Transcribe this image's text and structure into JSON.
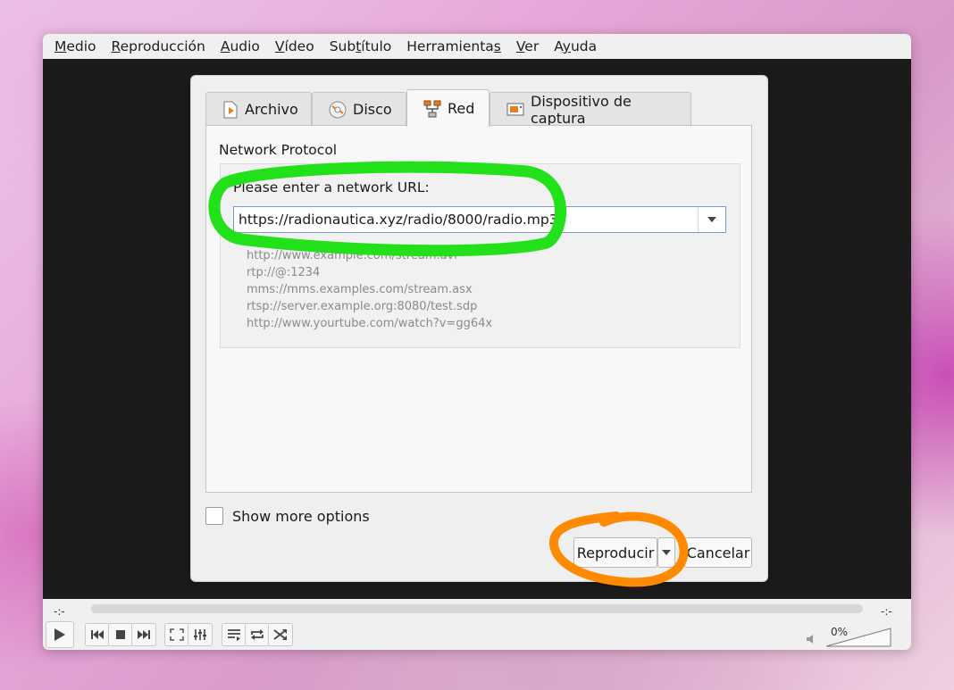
{
  "menubar": {
    "items": [
      {
        "label": "Medio",
        "accel": "M"
      },
      {
        "label": "Reproducción",
        "accel": "R"
      },
      {
        "label": "Audio",
        "accel": "A"
      },
      {
        "label": "Vídeo",
        "accel": "V"
      },
      {
        "label": "Subtítulo",
        "accel": "t"
      },
      {
        "label": "Herramientas",
        "accel": "s"
      },
      {
        "label": "Ver",
        "accel": "V"
      },
      {
        "label": "Ayuda",
        "accel": "y"
      }
    ]
  },
  "dialog": {
    "tabs": [
      {
        "label": "Archivo",
        "icon": "file-play-icon"
      },
      {
        "label": "Disco",
        "icon": "disc-icon"
      },
      {
        "label": "Red",
        "icon": "network-icon",
        "active": true
      },
      {
        "label": "Dispositivo de captura",
        "icon": "capture-device-icon"
      }
    ],
    "group_title": "Network Protocol",
    "url_label": "Please enter a network URL:",
    "url_value": "https://radionautica.xyz/radio/8000/radio.mp3",
    "examples": [
      "http://www.example.com/stream.avi",
      "rtp://@:1234",
      "mms://mms.examples.com/stream.asx",
      "rtsp://server.example.org:8080/test.sdp",
      "http://www.yourtube.com/watch?v=gg64x"
    ],
    "show_more_options": "Show more options",
    "show_more_checked": false,
    "play_button": "Reproducir",
    "cancel_button": "Cancelar"
  },
  "controls": {
    "elapsed": "-:-",
    "remaining": "-:-",
    "volume": "0%",
    "buttons": [
      "play-icon",
      "previous-icon",
      "stop-icon",
      "next-icon",
      "fullscreen-icon",
      "extended-settings-icon",
      "playlist-icon",
      "loop-icon",
      "shuffle-icon"
    ]
  },
  "annotations": {
    "highlight_url_color": "#22e01a",
    "highlight_play_color": "#ff8a00"
  }
}
